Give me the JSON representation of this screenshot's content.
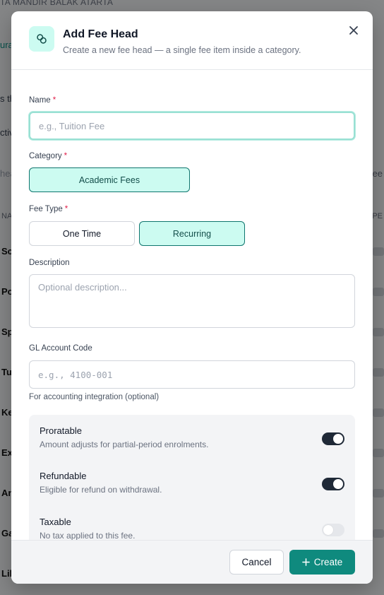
{
  "background": {
    "top_text": "TA MANDIR BALAK ATARTA",
    "side_texts": [
      "ura",
      "s th",
      "ctiv",
      "hea",
      "NA",
      "Sc",
      "Po",
      "Sp",
      "Tu",
      "Ke",
      "Ex",
      "An",
      "Ga",
      "Lib"
    ],
    "right_texts": [
      "ee",
      "PE"
    ]
  },
  "modal": {
    "title": "Add Fee Head",
    "subtitle": "Create a new fee head — a single fee item inside a category.",
    "header_icon": "link-chain-icon",
    "close_icon": "close-icon"
  },
  "form": {
    "name": {
      "label": "Name",
      "required": "*",
      "placeholder": "e.g., Tuition Fee"
    },
    "category": {
      "label": "Category",
      "required": "*",
      "selected": "Academic Fees"
    },
    "fee_type": {
      "label": "Fee Type",
      "required": "*",
      "options": [
        "One Time",
        "Recurring"
      ],
      "selected": "Recurring"
    },
    "description": {
      "label": "Description",
      "placeholder": "Optional description..."
    },
    "gl_account": {
      "label": "GL Account Code",
      "placeholder": "e.g., 4100-001",
      "hint": "For accounting integration (optional)"
    }
  },
  "toggles": [
    {
      "title": "Proratable",
      "description": "Amount adjusts for partial-period enrolments.",
      "on": true
    },
    {
      "title": "Refundable",
      "description": "Eligible for refund on withdrawal.",
      "on": true
    },
    {
      "title": "Taxable",
      "description": "No tax applied to this fee.",
      "on": false
    }
  ],
  "footer": {
    "cancel_label": "Cancel",
    "create_label": "Create",
    "create_icon": "plus-icon"
  },
  "colors": {
    "accent": "#0f8a7e",
    "accent_light": "#ccfbf1",
    "toggle_on": "#1f2937"
  }
}
